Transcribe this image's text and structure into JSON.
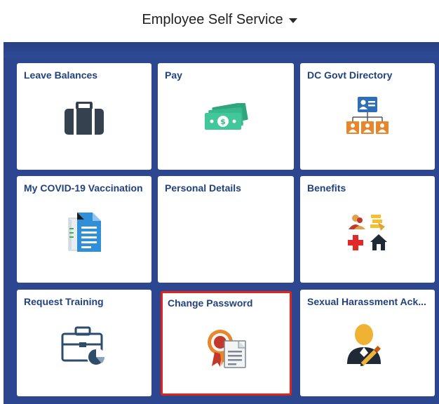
{
  "header": {
    "title": "Employee Self Service"
  },
  "colors": {
    "background": "#2d4690",
    "tile": "#ffffff",
    "label": "#21427f",
    "highlight": "#e2231a"
  },
  "tiles": [
    {
      "label": "Leave Balances",
      "icon": "briefcase-icon"
    },
    {
      "label": "Pay",
      "icon": "money-icon"
    },
    {
      "label": "DC Govt Directory",
      "icon": "org-chart-icon"
    },
    {
      "label": "My COVID-19 Vaccination",
      "icon": "document-icon"
    },
    {
      "label": "Personal Details",
      "icon": ""
    },
    {
      "label": "Benefits",
      "icon": "benefits-icon"
    },
    {
      "label": "Request Training",
      "icon": "training-case-icon"
    },
    {
      "label": "Change Password",
      "icon": "certificate-icon",
      "highlighted": true
    },
    {
      "label": "Sexual Harassment Ack...",
      "icon": "user-sign-icon"
    }
  ]
}
